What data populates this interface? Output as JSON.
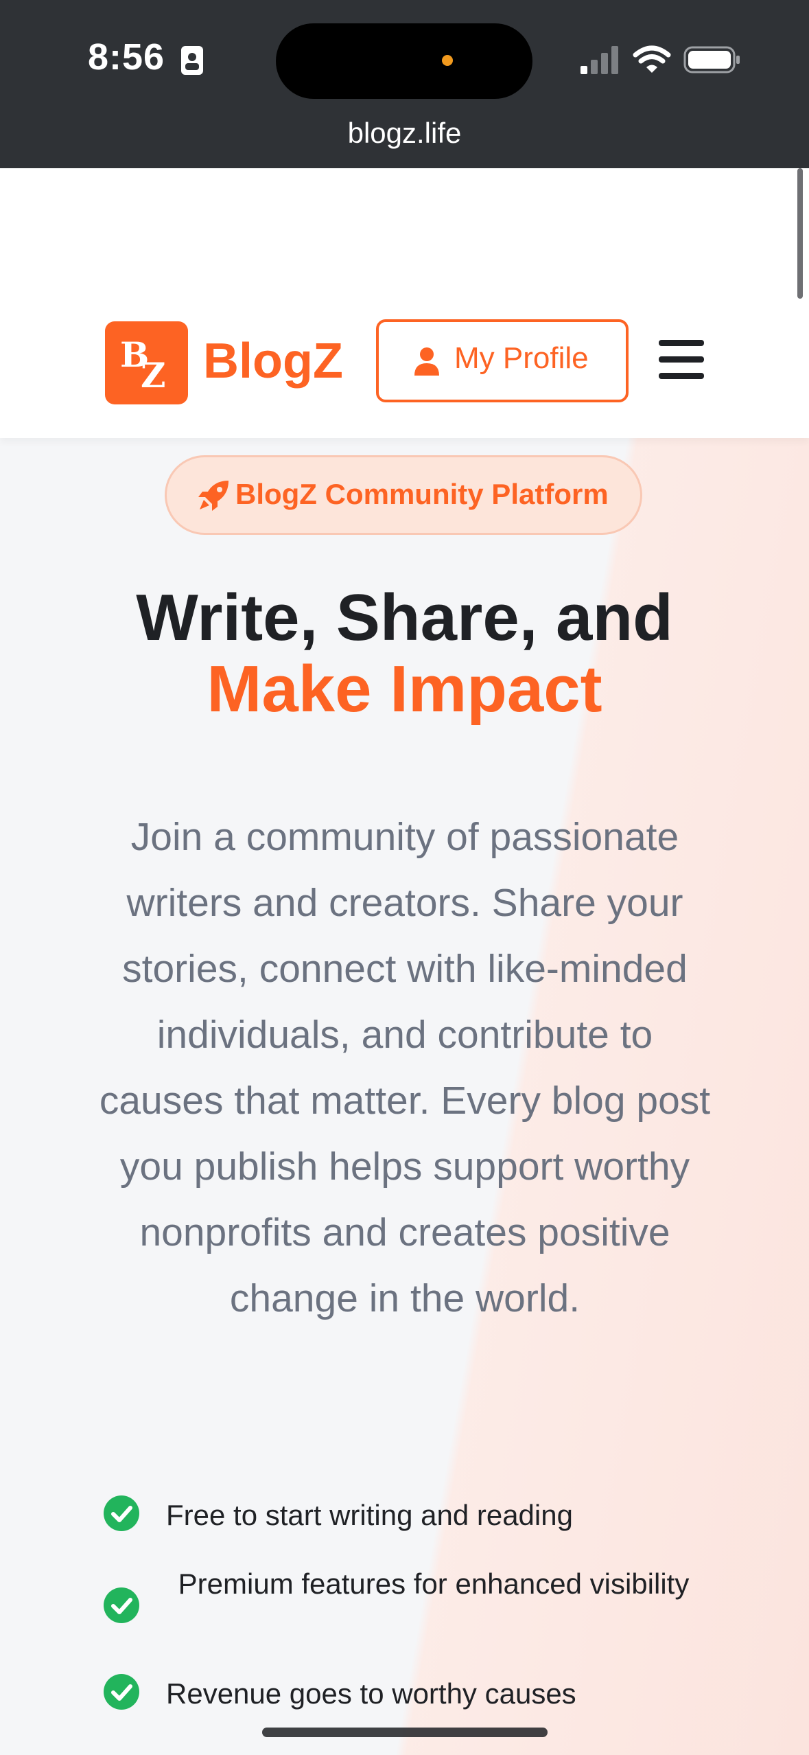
{
  "status_bar": {
    "time": "8:56",
    "icons": [
      "contact-card-icon",
      "signal-icon",
      "wifi-icon",
      "battery-icon"
    ],
    "island_dot_color": "#f19a1e"
  },
  "browser": {
    "url": "blogz.life"
  },
  "header": {
    "logo_mark": "BZ",
    "brand_name": "BlogZ",
    "profile_button_label": "My Profile",
    "menu_icon": "hamburger-menu-icon"
  },
  "hero": {
    "badge_label": "BlogZ Community Platform",
    "title_line1": "Write, Share, and",
    "title_line2": "Make Impact",
    "description": "Join a community of passionate writers and creators. Share your stories, connect with like-minded individuals, and contribute to causes that matter. Every blog post you publish helps support worthy nonprofits and creates positive change in the world.",
    "features": [
      "Free to start writing and reading",
      "Premium features for enhanced visibility",
      "Revenue goes to worthy causes"
    ]
  },
  "colors": {
    "accent": "#fd6323",
    "text_dark": "#1f2125",
    "text_muted": "#6b7280",
    "check_green": "#22b45c",
    "chrome_bg": "#2f3236"
  }
}
